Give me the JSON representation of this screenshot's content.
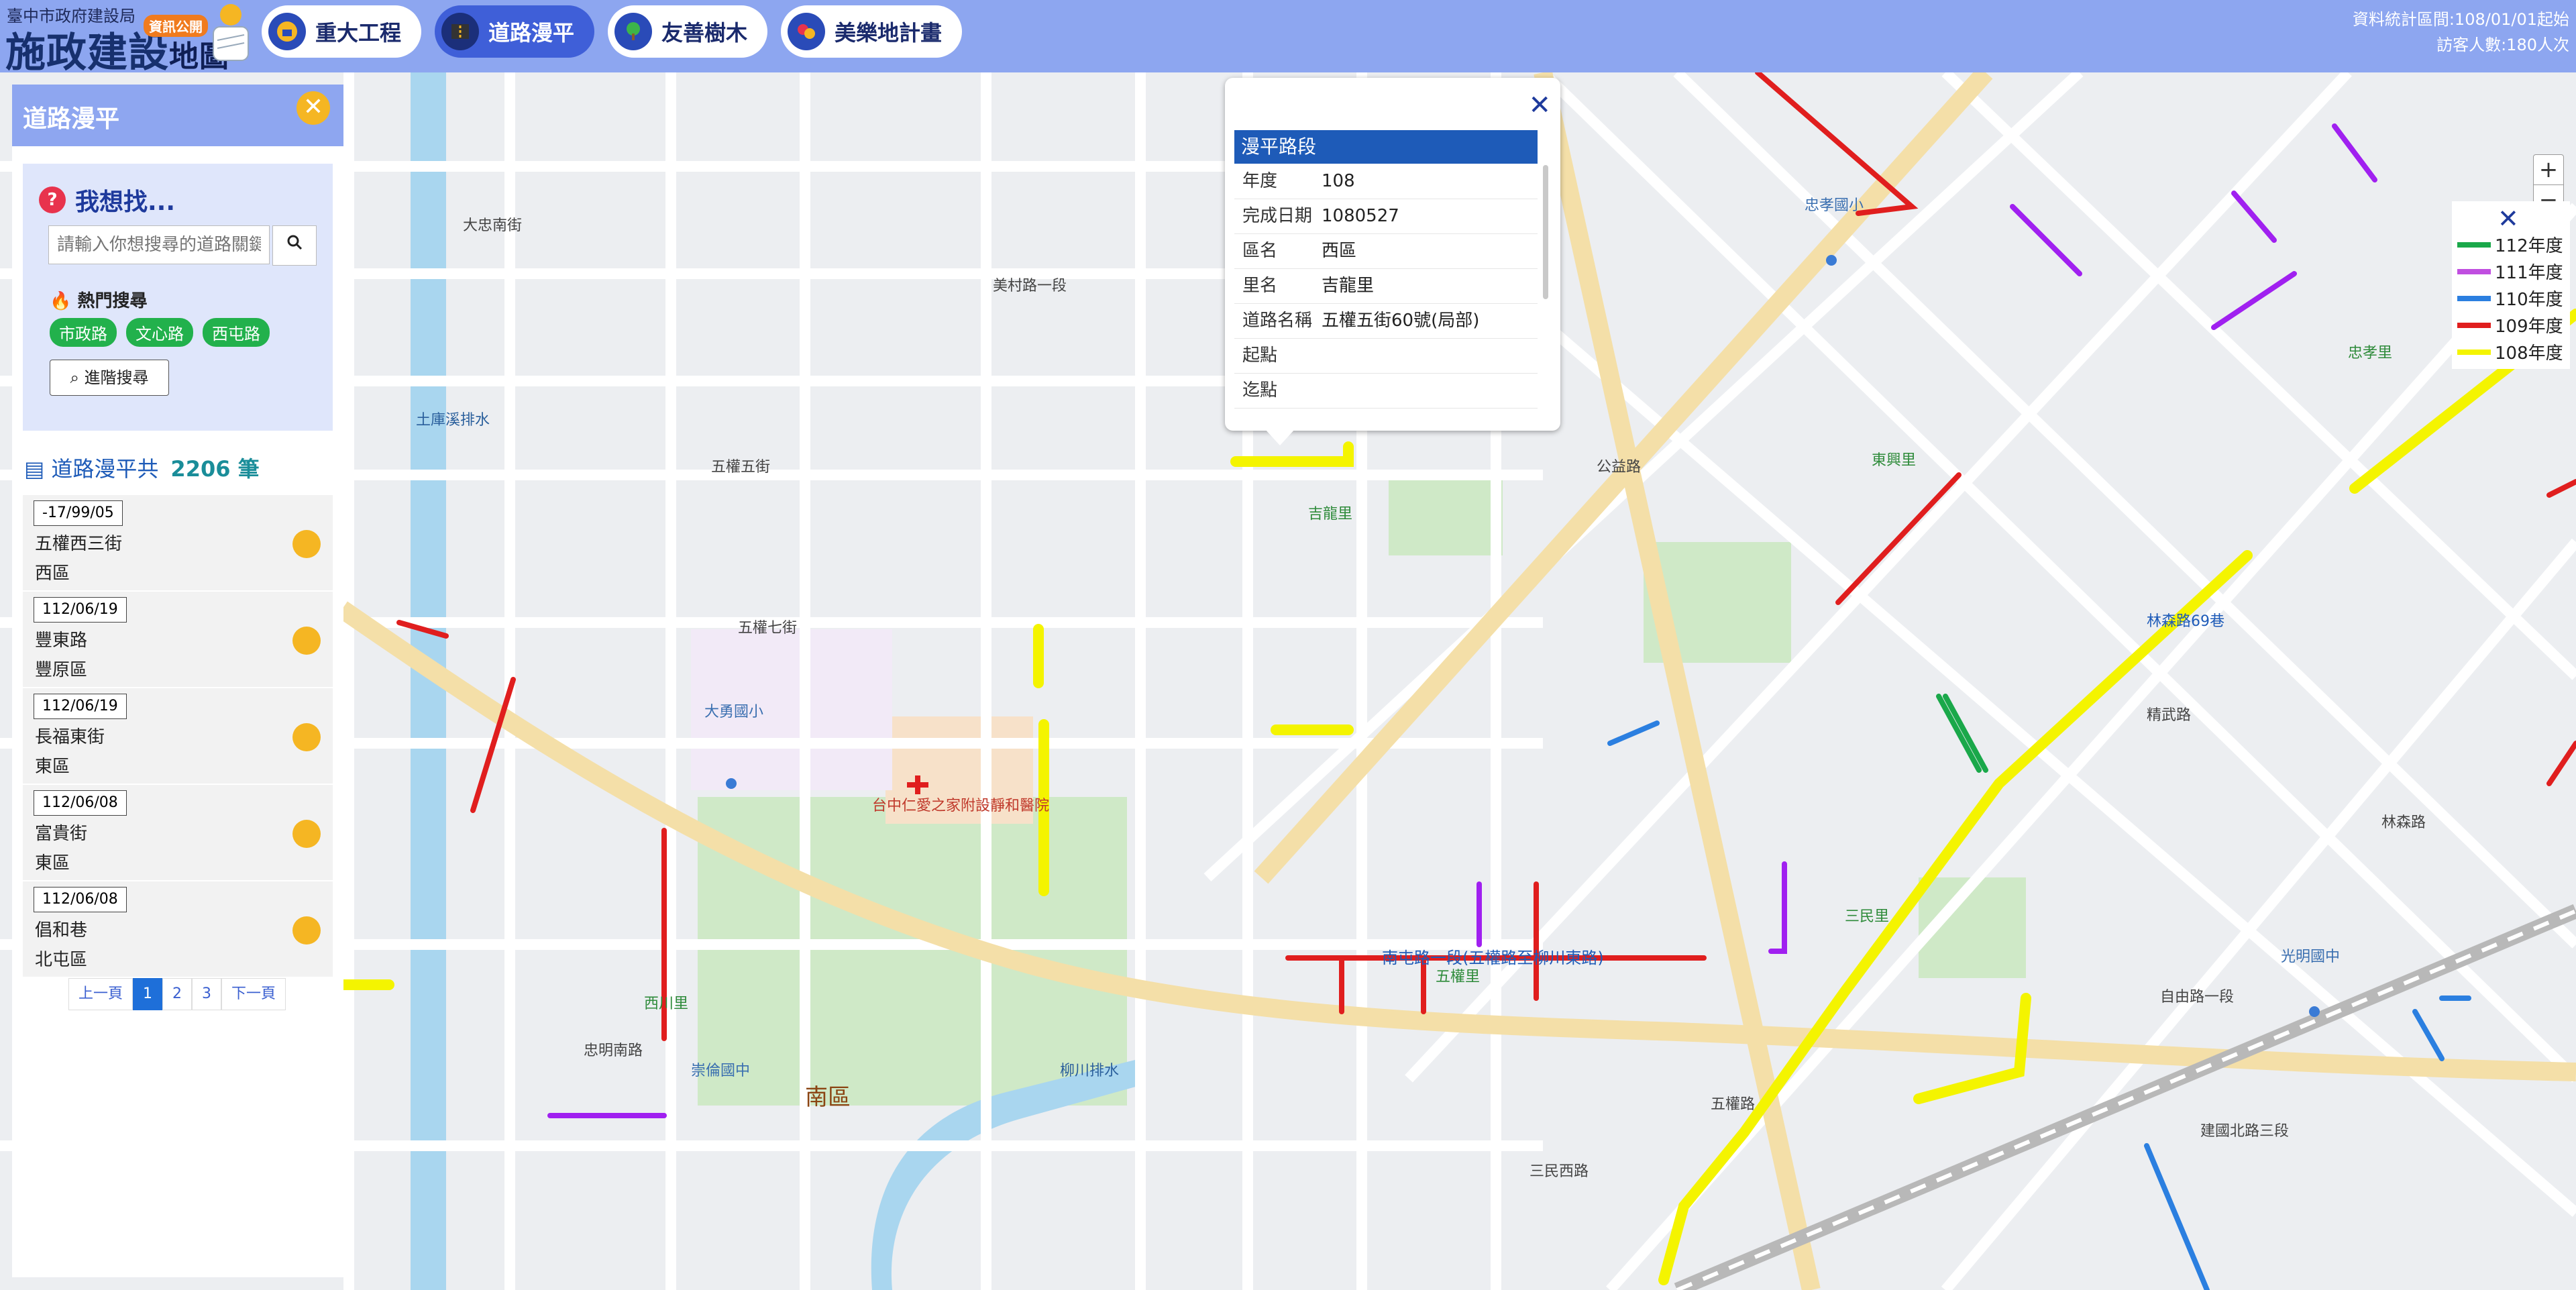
{
  "header": {
    "subtitle": "臺中市政府建設局",
    "title_main": "施政建設",
    "title_small": "地圖",
    "badge": "資訊公開",
    "nav": [
      {
        "label": "重大工程",
        "icon": "construction-icon",
        "active": false
      },
      {
        "label": "道路漫平",
        "icon": "road-icon",
        "active": true
      },
      {
        "label": "友善樹木",
        "icon": "tree-icon",
        "active": false
      },
      {
        "label": "美樂地計畫",
        "icon": "playground-icon",
        "active": false
      }
    ],
    "stats_range": "資料統計區間:108/01/01起始",
    "visitors": "訪客人數:180人次"
  },
  "panel": {
    "title": "道路漫平",
    "search_heading": "我想找...",
    "search_placeholder": "請輸入你想搜尋的道路關鍵字",
    "hot_label": "熱門搜尋",
    "hot_tags": [
      "市政路",
      "文心路",
      "西屯路"
    ],
    "advanced_label": "進階搜尋",
    "count_label": "道路漫平共",
    "count_value": "2206 筆",
    "items": [
      {
        "date": "-17/99/05",
        "road": "五權西三街",
        "district": "西區"
      },
      {
        "date": "112/06/19",
        "road": "豐東路",
        "district": "豐原區"
      },
      {
        "date": "112/06/19",
        "road": "長福東街",
        "district": "東區"
      },
      {
        "date": "112/06/08",
        "road": "富貴街",
        "district": "東區"
      },
      {
        "date": "112/06/08",
        "road": "倡和巷",
        "district": "北屯區"
      }
    ],
    "pager": {
      "prev": "上一頁",
      "pages": [
        "1",
        "2",
        "3"
      ],
      "current": "1",
      "next": "下一頁"
    }
  },
  "popup": {
    "header": "漫平路段",
    "rows": [
      {
        "key": "年度",
        "value": "108"
      },
      {
        "key": "完成日期",
        "value": "1080527"
      },
      {
        "key": "區名",
        "value": "西區"
      },
      {
        "key": "里名",
        "value": "吉龍里"
      },
      {
        "key": "道路名稱",
        "value": "五權五街60號(局部)"
      },
      {
        "key": "起點",
        "value": ""
      },
      {
        "key": "迄點",
        "value": ""
      }
    ]
  },
  "legend": [
    {
      "label": "112年度",
      "color": "#1aa84a"
    },
    {
      "label": "111年度",
      "color": "#c04ee0"
    },
    {
      "label": "110年度",
      "color": "#2b7fe0"
    },
    {
      "label": "109年度",
      "color": "#e01e1e"
    },
    {
      "label": "108年度",
      "color": "#f4f400"
    }
  ],
  "map": {
    "zoom_in": "+",
    "zoom_out": "−",
    "labels": [
      {
        "text": "南區",
        "cls": "big"
      },
      {
        "text": "五權五街"
      },
      {
        "text": "五權七街"
      },
      {
        "text": "南屯路一段(五權路至柳川東路)"
      },
      {
        "text": "柳川排水"
      },
      {
        "text": "公益路"
      },
      {
        "text": "自由路一段"
      },
      {
        "text": "建國北路三段"
      },
      {
        "text": "精武路"
      },
      {
        "text": "林森路"
      },
      {
        "text": "三民西路"
      },
      {
        "text": "美村路一段"
      },
      {
        "text": "台中仁愛之家附設靜和醫院"
      },
      {
        "text": "土庫溪排水"
      },
      {
        "text": "大勇國小"
      },
      {
        "text": "忠孝國小"
      },
      {
        "text": "忠明南路"
      },
      {
        "text": "光明國中"
      },
      {
        "text": "崇倫國中"
      },
      {
        "text": "東興里"
      },
      {
        "text": "忠孝里"
      },
      {
        "text": "西川里"
      },
      {
        "text": "三民里"
      },
      {
        "text": "五權里"
      },
      {
        "text": "大忠南街"
      },
      {
        "text": "林森路69巷"
      },
      {
        "text": "五權路"
      },
      {
        "text": "吉龍里"
      }
    ]
  }
}
